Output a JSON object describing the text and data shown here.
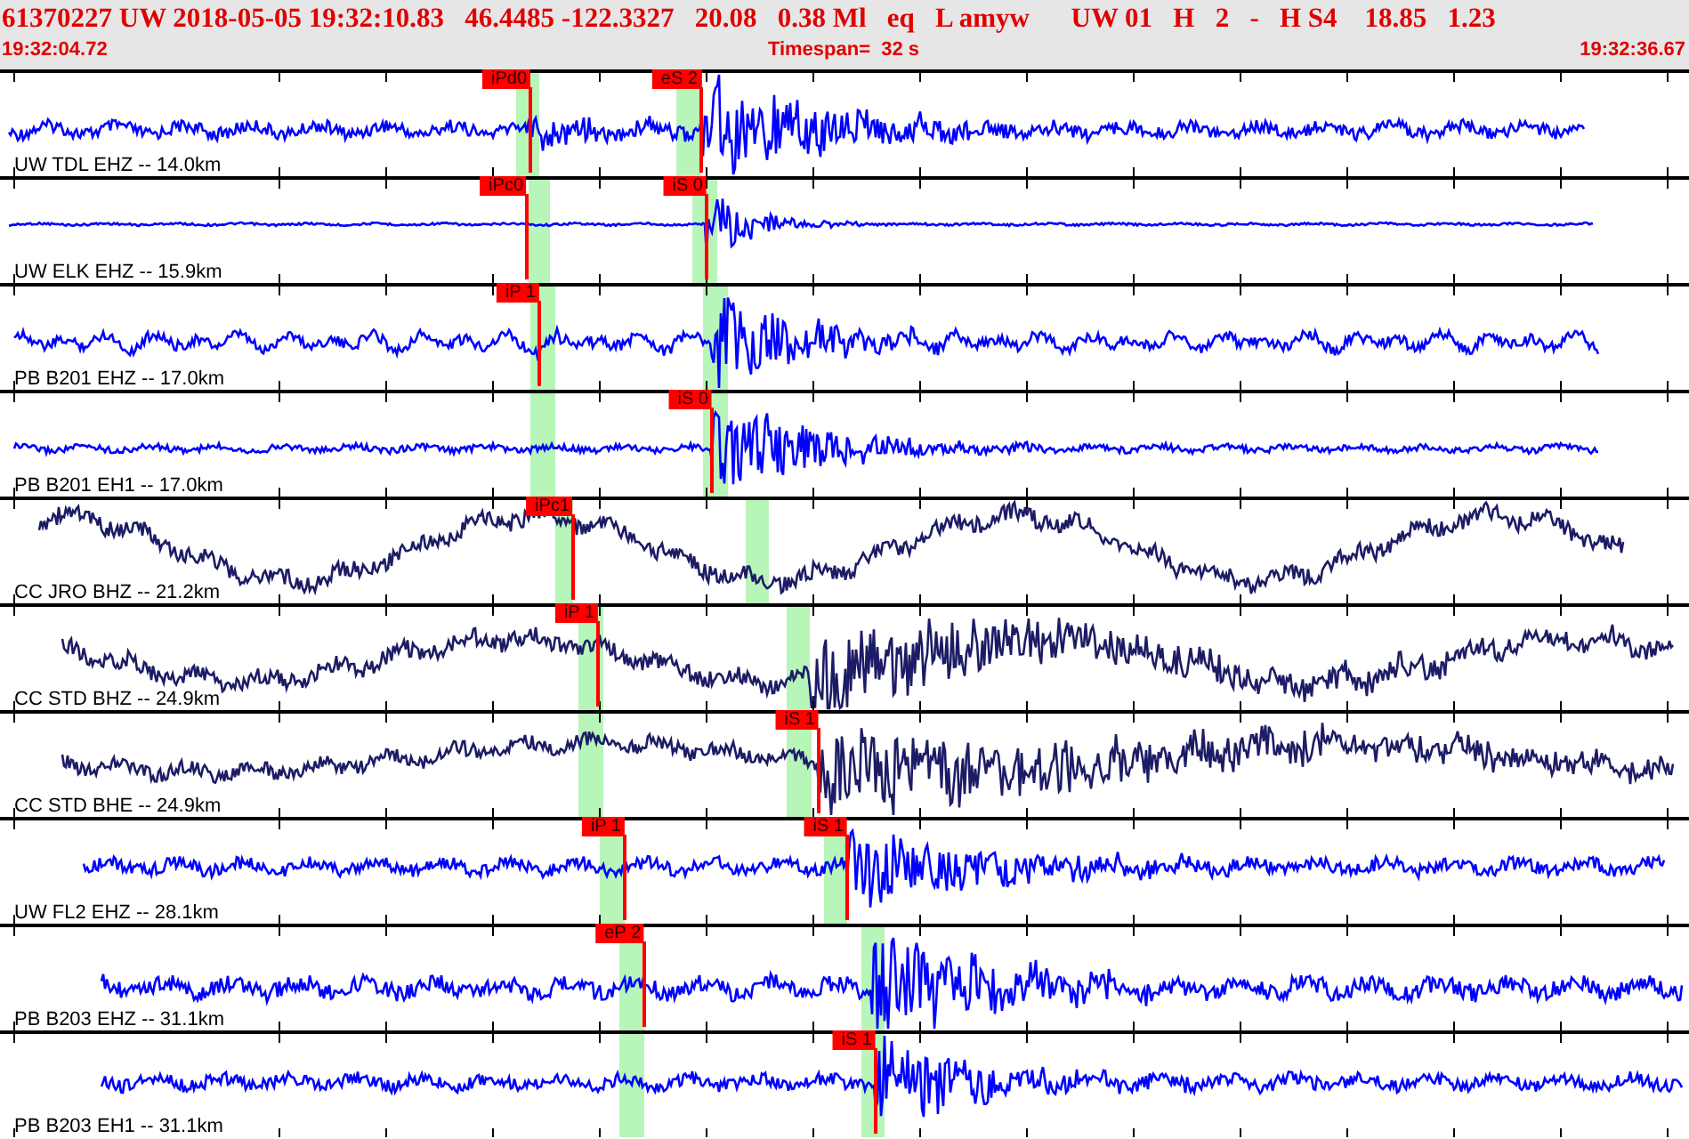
{
  "header": {
    "event_line": "61370227 UW 2018-05-05 19:32:10.83   46.4485 -122.3327   20.08   0.38 Ml   eq   L amyw      UW 01   H   2   -   H S4    18.85   1.23",
    "start_time": "19:32:04.72",
    "timespan": "Timespan=  32 s",
    "end_time": "19:32:36.67"
  },
  "traces": [
    {
      "label": "UW TDL EHZ -- 14.0km",
      "color": "#0000ff",
      "picks": [
        {
          "label": "iPd0"
        },
        {
          "label": "eS 2"
        }
      ]
    },
    {
      "label": "UW ELK EHZ -- 15.9km",
      "color": "#0000ff",
      "picks": [
        {
          "label": "iPc0"
        },
        {
          "label": "iS 0"
        }
      ]
    },
    {
      "label": "PB B201 EHZ -- 17.0km",
      "color": "#0000ff",
      "picks": [
        {
          "label": "iP 1"
        }
      ]
    },
    {
      "label": "PB B201 EH1 -- 17.0km",
      "color": "#0000ff",
      "picks": [
        {
          "label": "iS 0"
        }
      ]
    },
    {
      "label": "CC JRO BHZ -- 21.2km",
      "color": "#1c1c66",
      "picks": [
        {
          "label": "iPc1"
        }
      ]
    },
    {
      "label": "CC STD BHZ -- 24.9km",
      "color": "#1c1c66",
      "picks": [
        {
          "label": "iP 1"
        }
      ]
    },
    {
      "label": "CC STD BHE -- 24.9km",
      "color": "#1c1c66",
      "picks": [
        {
          "label": "iS 1"
        }
      ]
    },
    {
      "label": "UW FL2 EHZ -- 28.1km",
      "color": "#0000ff",
      "picks": [
        {
          "label": "iP 1"
        },
        {
          "label": "iS 1"
        }
      ]
    },
    {
      "label": "PB B203 EHZ -- 31.1km",
      "color": "#0000ff",
      "picks": [
        {
          "label": "eP 2"
        }
      ]
    },
    {
      "label": "PB B203 EH1 -- 31.1km",
      "color": "#0000ff",
      "picks": [
        {
          "label": "iS 1"
        }
      ]
    }
  ]
}
